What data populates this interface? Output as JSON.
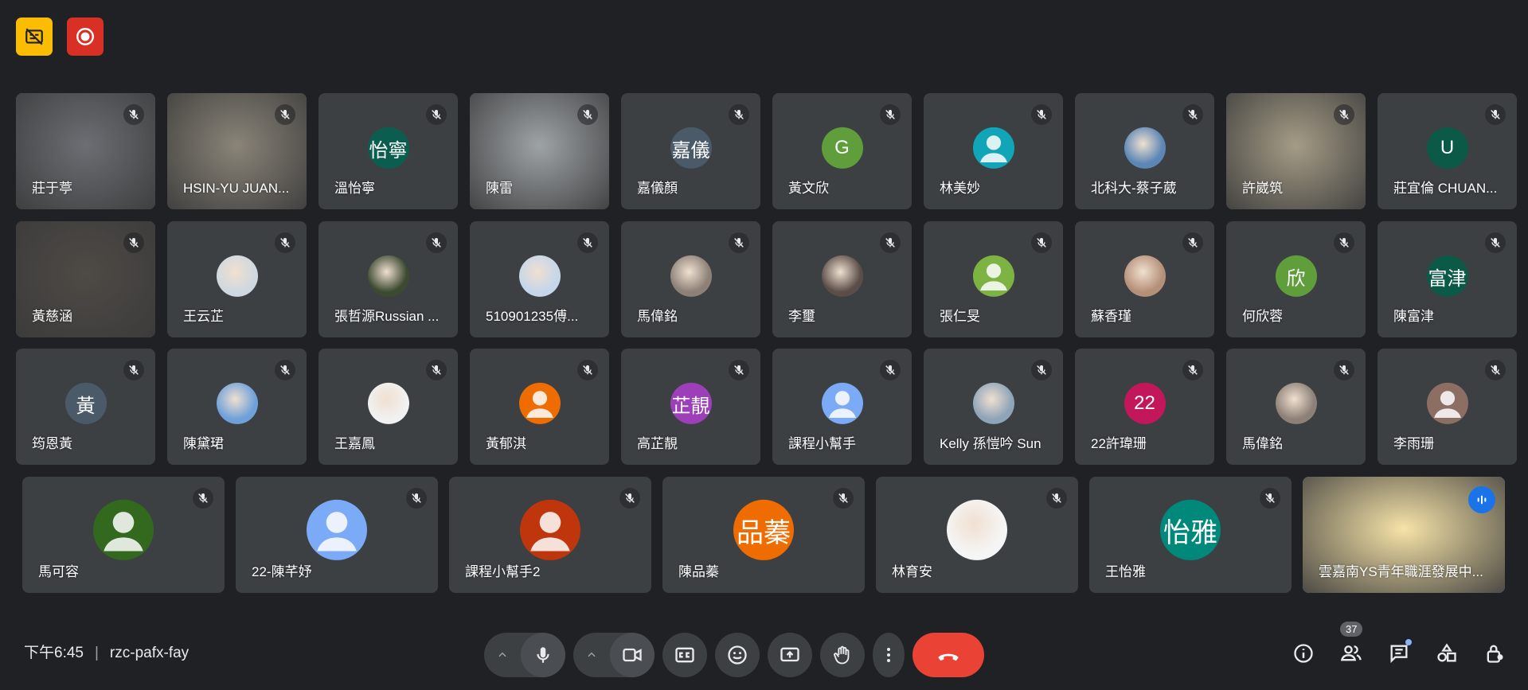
{
  "meeting": {
    "time": "下午6:45",
    "code": "rzc-pafx-fay",
    "participant_count": "37"
  },
  "colors": {
    "background": "#202124",
    "tile": "#3c4043",
    "end_call": "#ea4335",
    "caption_badge": "#fbbc04",
    "record_badge": "#d93025",
    "active_outline": "#8ab4f8"
  },
  "rows": [
    [
      {
        "name": "莊于葶",
        "type": "video",
        "bg": "#6b6e73"
      },
      {
        "name": "HSIN-YU JUAN...",
        "type": "video",
        "bg": "#8a8478"
      },
      {
        "name": "溫怡寧",
        "type": "initials",
        "initials": "怡寧",
        "color": "#0b5e4f"
      },
      {
        "name": "陳雷",
        "type": "video",
        "bg": "#9ea3a6"
      },
      {
        "name": "嘉儀顏",
        "type": "initials",
        "initials": "嘉儀",
        "color": "#4a5a68"
      },
      {
        "name": "黃文欣",
        "type": "initials",
        "initials": "G",
        "color": "#5f9e3b"
      },
      {
        "name": "林美妙",
        "type": "person",
        "color": "#12a4b7"
      },
      {
        "name": "北科大-蔡子葳",
        "type": "photo",
        "color": "#5b86b5"
      },
      {
        "name": "許崴筑",
        "type": "video",
        "bg": "#a59c86"
      },
      {
        "name": "莊宜倫 CHUAN...",
        "type": "initials",
        "initials": "U",
        "color": "#0b5a47"
      }
    ],
    [
      {
        "name": "黃慈涵",
        "type": "video",
        "bg": "#4e4a45"
      },
      {
        "name": "王云芷",
        "type": "photo",
        "color": "#cfd8e0"
      },
      {
        "name": "張哲源Russian ...",
        "type": "photo",
        "color": "#3d4a32"
      },
      {
        "name": "510901235傅...",
        "type": "photo",
        "color": "#c5d6ea"
      },
      {
        "name": "馬偉銘",
        "type": "photo",
        "color": "#8c8077"
      },
      {
        "name": "李璽",
        "type": "photo",
        "color": "#5b4e48"
      },
      {
        "name": "張仁旻",
        "type": "person",
        "color": "#7cb342"
      },
      {
        "name": "蘇香瑾",
        "type": "photo",
        "color": "#b59079"
      },
      {
        "name": "何欣蓉",
        "type": "initials",
        "initials": "欣",
        "color": "#5f9e3b"
      },
      {
        "name": "陳富津",
        "type": "initials",
        "initials": "富津",
        "color": "#0b5a47"
      }
    ],
    [
      {
        "name": "筠恩黃",
        "type": "initials",
        "initials": "黃",
        "color": "#4a5a68"
      },
      {
        "name": "陳黛珺",
        "type": "photo",
        "color": "#6fa0d9"
      },
      {
        "name": "王嘉鳳",
        "type": "photo",
        "color": "#f1f1f1"
      },
      {
        "name": "黃郁淇",
        "type": "person",
        "color": "#ef6c00"
      },
      {
        "name": "高芷靚",
        "type": "initials",
        "initials": "芷靚",
        "color": "#9c3fb8"
      },
      {
        "name": "課程小幫手",
        "type": "person",
        "color": "#7baaf7"
      },
      {
        "name": "Kelly 孫愷吟 Sun",
        "type": "photo",
        "color": "#8ea4b8"
      },
      {
        "name": "22許瑋珊",
        "type": "initials",
        "initials": "22",
        "color": "#c2185b"
      },
      {
        "name": "馬偉銘",
        "type": "photo",
        "color": "#8c8077"
      },
      {
        "name": "李雨珊",
        "type": "person",
        "color": "#8d6e63"
      }
    ],
    [
      {
        "name": "馬可容",
        "type": "person",
        "color": "#33691e"
      },
      {
        "name": "22-陳芊妤",
        "type": "person",
        "color": "#7baaf7"
      },
      {
        "name": "課程小幫手2",
        "type": "person",
        "color": "#bf360c"
      },
      {
        "name": "陳品蓁",
        "type": "initials",
        "initials": "品蓁",
        "color": "#ef6c00"
      },
      {
        "name": "林育安",
        "type": "photo",
        "color": "#f5f5f5"
      },
      {
        "name": "王怡雅",
        "type": "initials",
        "initials": "怡雅",
        "color": "#00897b"
      },
      {
        "name": "雲嘉南YS青年職涯發展中...",
        "type": "video",
        "bg": "#f6e3a8",
        "active": true
      }
    ]
  ]
}
